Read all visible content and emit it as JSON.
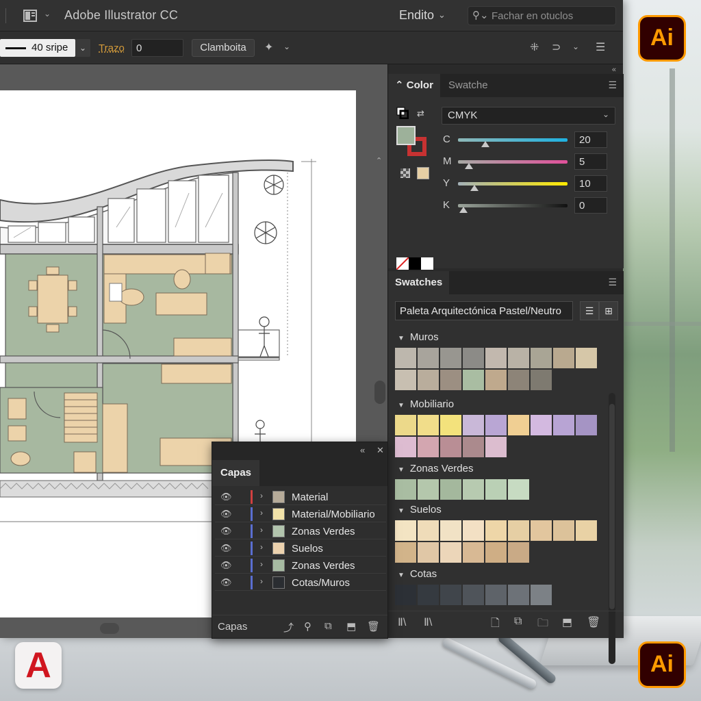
{
  "titlebar": {
    "app_title": "Adobe Illustrator CC",
    "workspace": "Endito",
    "search_placeholder": "Fachar en otuclos"
  },
  "controlbar": {
    "stroke_profile": "40 sripe",
    "stroke_label": "Trazo",
    "stroke_value": "0",
    "style_button": "Clamboita"
  },
  "color_panel": {
    "tabs": [
      "Color",
      "Swatche"
    ],
    "mode": "CMYK",
    "fill_color": "#9db19a",
    "stroke_color": "#c73232",
    "sliders": [
      {
        "label": "C",
        "value": "20",
        "fraction": 0.2
      },
      {
        "label": "M",
        "value": "5",
        "fraction": 0.05
      },
      {
        "label": "Y",
        "value": "10",
        "fraction": 0.1
      },
      {
        "label": "K",
        "value": "0",
        "fraction": 0.0
      }
    ]
  },
  "swatches_panel": {
    "tab": "Swatches",
    "library": "Paleta Arquitectónica Pastel/Neutro",
    "groups": [
      {
        "name": "Muros",
        "colors": [
          "#bdb7ad",
          "#a8a49c",
          "#989690",
          "#8c8b87",
          "#c2b8ae",
          "#b9b2a6",
          "#a9a595",
          "#b9a98f",
          "#d6c7a8",
          "#c8bfb1",
          "#b9ad9c",
          "#9c8f82",
          "#a9bda2",
          "#bfa98d",
          "#8d8478",
          "#7e7a70"
        ]
      },
      {
        "name": "Mobiliario",
        "colors": [
          "#ecd98a",
          "#f1dd8a",
          "#f3e27c",
          "#c9b8d8",
          "#b9a6d4",
          "#f0cf93",
          "#d3b9e0",
          "#b8a4d4",
          "#a594c4",
          "#ddbcd1",
          "#d3a6b0",
          "#b98e95",
          "#ab8a8d",
          "#dcbdcf"
        ]
      },
      {
        "name": "Zonas Verdes",
        "colors": [
          "#a9bda2",
          "#b4c7ac",
          "#a4b89d",
          "#b7cab0",
          "#bad0b5",
          "#c7dbc2"
        ]
      },
      {
        "name": "Suelos",
        "colors": [
          "#f3e4c3",
          "#efdcb9",
          "#f1e2c5",
          "#f3e0c4",
          "#eed6a8",
          "#e6cfa4",
          "#e2c69e",
          "#dcc29a",
          "#e9d2a5",
          "#d2b48a",
          "#e0c7a6",
          "#ecd6b9",
          "#d8b994",
          "#cfae85",
          "#c9aa86"
        ]
      },
      {
        "name": "Cotas",
        "colors": [
          "#2c3036",
          "#353a40",
          "#40454b",
          "#4f545a",
          "#5e6369",
          "#6d7278",
          "#7c8186"
        ]
      }
    ]
  },
  "layers_panel": {
    "title": "Capas",
    "footer_label": "Capas",
    "layers": [
      {
        "name": "Material",
        "thumb": "#b6ab99",
        "bar": "#d04040"
      },
      {
        "name": "Material/Mobiliario",
        "thumb": "#f1e2a9",
        "bar": "#5a6ed0"
      },
      {
        "name": "Zonas Verdes",
        "thumb": "#b2c4ad",
        "bar": "#5a6ed0"
      },
      {
        "name": "Suelos",
        "thumb": "#ecd2ae",
        "bar": "#5a6ed0"
      },
      {
        "name": "Zonas Verdes",
        "thumb": "#a7bba2",
        "bar": "#5a6ed0"
      },
      {
        "name": "Cotas/Muros",
        "thumb": "#2a2d31",
        "bar": "#5a6ed0"
      }
    ]
  },
  "logos": {
    "illustrator": "Ai",
    "autocad": "A"
  }
}
